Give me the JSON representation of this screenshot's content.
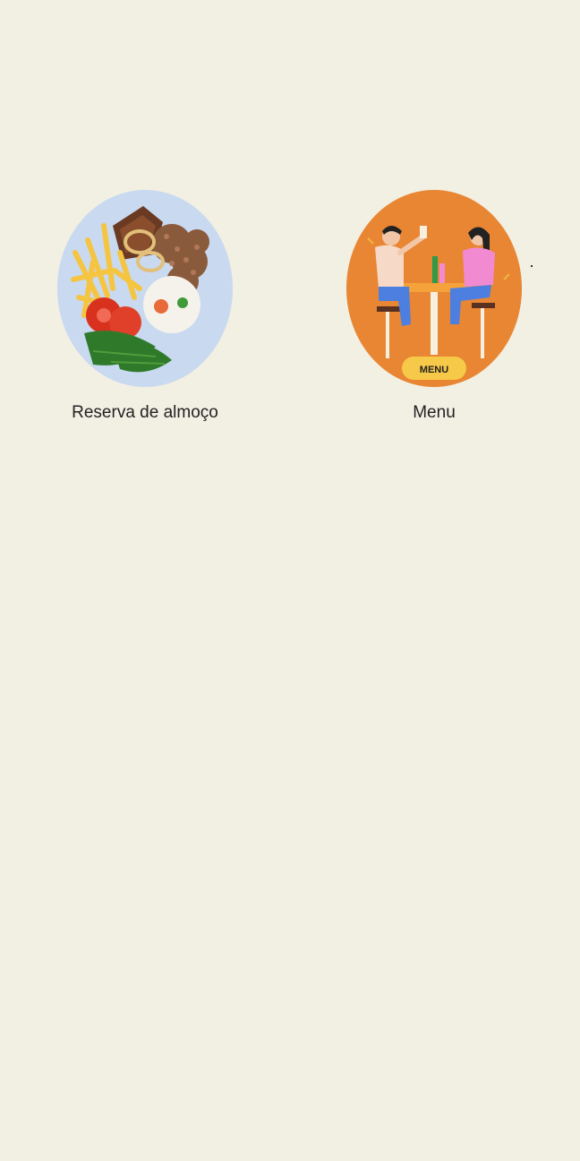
{
  "tiles": [
    {
      "label": "Reserva de almoço",
      "image": "plate-food-icon"
    },
    {
      "label": "Menu",
      "image": "couple-dining-menu-icon",
      "badge": "MENU"
    }
  ],
  "colors": {
    "background": "#f2efe3",
    "plate_bg": "#c9d9f0",
    "menu_bg": "#e88633",
    "menu_badge": "#f7c948"
  }
}
